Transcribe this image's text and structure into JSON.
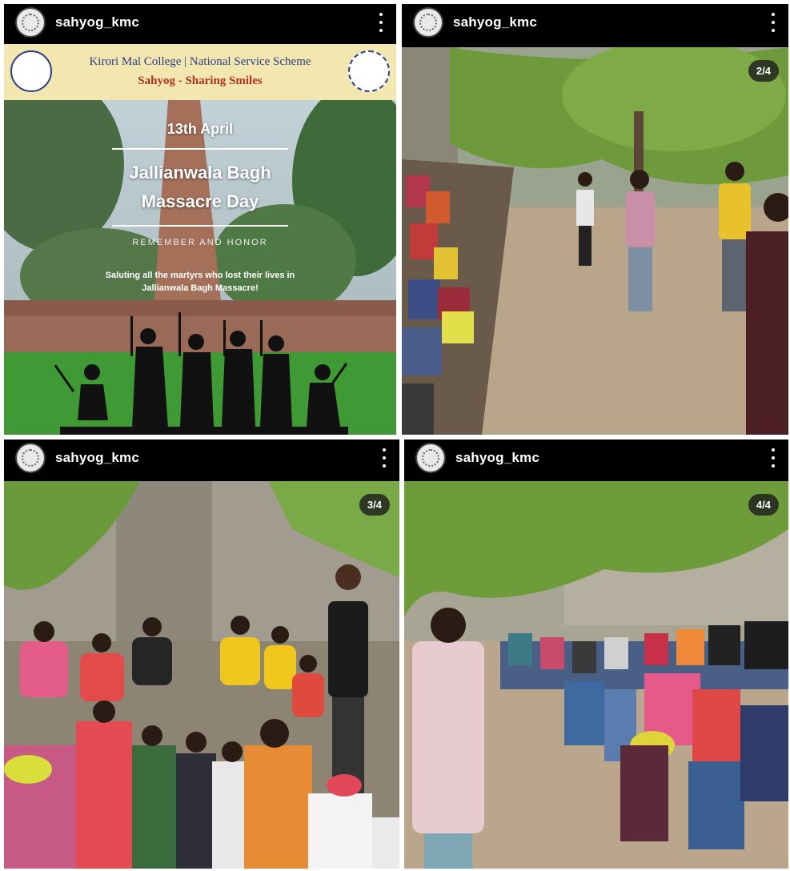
{
  "posts": [
    {
      "username": "sahyog_kmc",
      "counter": "",
      "poster": {
        "college_line": "Kirori Mal College | National Service Scheme",
        "subtitle": "Sahyog - Sharing Smiles",
        "date": "13th April",
        "title_line1": "Jallianwala Bagh",
        "title_line2": "Massacre Day",
        "tagline": "REMEMBER AND HONOR",
        "message_line1": "Saluting all the martyrs who lost their lives in",
        "message_line2": "Jallianwala Bagh Massacre!"
      }
    },
    {
      "username": "sahyog_kmc",
      "counter": "2/4"
    },
    {
      "username": "sahyog_kmc",
      "counter": "3/4"
    },
    {
      "username": "sahyog_kmc",
      "counter": "4/4"
    }
  ],
  "icons": {
    "more": "more-vertical-icon",
    "avatar": "profile-avatar"
  },
  "colors": {
    "header_bg": "#000000",
    "poster_banner": "#f3e7b0",
    "poster_title_text": "#ffffff",
    "grass": "#3f9a35",
    "foliage": "#6e9a3c",
    "ground": "#b8a58a",
    "wall": "#9d9689"
  }
}
